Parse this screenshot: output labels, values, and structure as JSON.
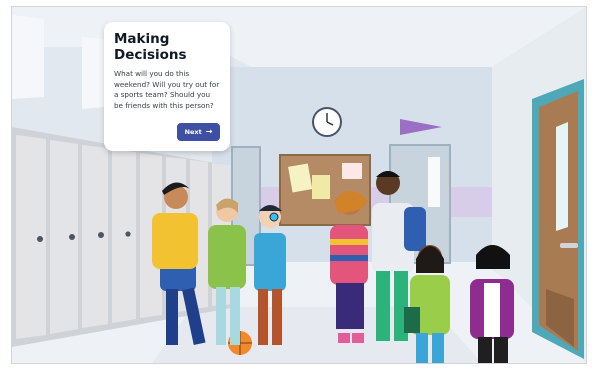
{
  "card": {
    "title": "Making Decisions",
    "body": "What will you do this weekend? Will you try out for a sports team? Should you be friends with this person?",
    "next_label": "Next",
    "next_icon": "→"
  },
  "colors": {
    "accent": "#3f4fa3",
    "wall": "#dfe6ee",
    "floor": "#eef1f5",
    "locker": "#e4e4e7",
    "door": "#a97b52",
    "door_frame": "#4fa8b8"
  }
}
